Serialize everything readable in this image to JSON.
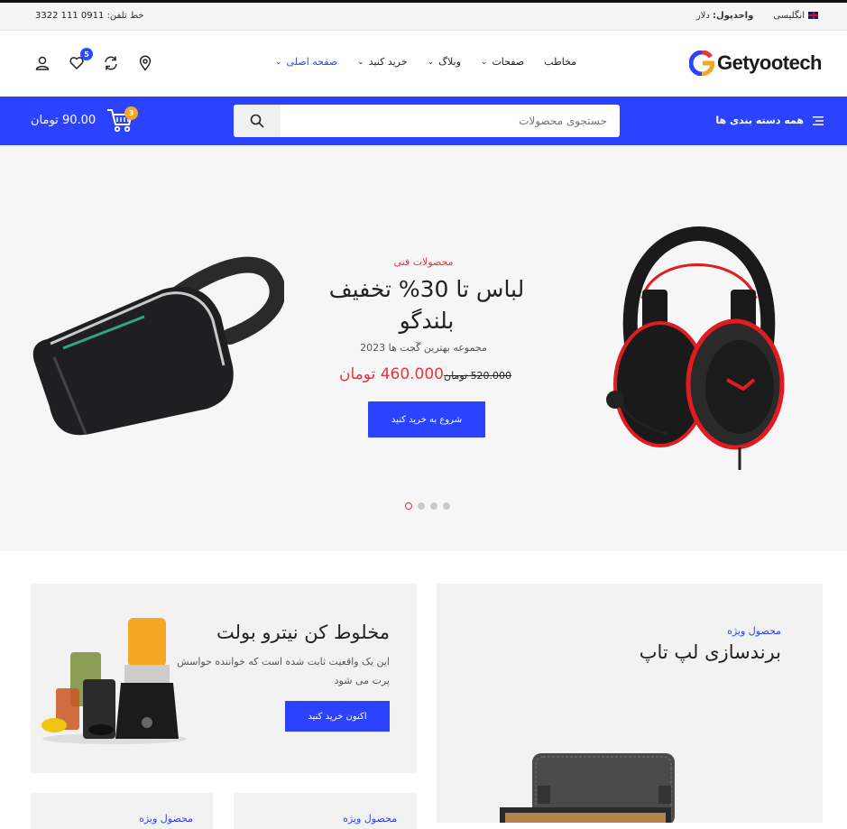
{
  "topbar": {
    "phone_label": "خط تلفن:",
    "phone_number": "0911 111 3322",
    "language": "انگلیسی",
    "currency_label": "واحدپول:",
    "currency_value": "دلار"
  },
  "header": {
    "logo_text": "Getyootech",
    "nav": [
      {
        "label": "صفحه اصلی",
        "active": true,
        "has_dropdown": true
      },
      {
        "label": "خرید کنید",
        "active": false,
        "has_dropdown": true
      },
      {
        "label": "وبلاگ",
        "active": false,
        "has_dropdown": true
      },
      {
        "label": "صفحات",
        "active": false,
        "has_dropdown": true
      },
      {
        "label": "مخاطب",
        "active": false,
        "has_dropdown": false
      }
    ],
    "wishlist_count": "5",
    "icons": [
      "user-icon",
      "heart-icon",
      "compare-icon",
      "location-icon"
    ]
  },
  "bluebar": {
    "categories_label": "همه دسته بندی ها",
    "search_placeholder": "جستجوی محصولات",
    "cart_count": "3",
    "cart_amount": "90.00 تومان"
  },
  "hero": {
    "subtitle": "محصولات فنی",
    "title": "لباس تا 30% تخفیف بلندگو",
    "description": "مجموعه بهترین گَجت ها 2023",
    "old_price": "520.000 تومان",
    "new_price": "460.000 تومان",
    "cta_label": "شروع به خرید کنید",
    "slides": 4,
    "active_slide": 0
  },
  "promos": {
    "blender": {
      "title": "مخلوط کن نیترو بولت",
      "description": "این یک واقعیت ثابت شده است که خواننده حواسش پرت می شود",
      "button": "اکنون خرید کنید"
    },
    "laptop": {
      "label": "محصول ویژه",
      "title": "برندسازی لپ تاپ"
    },
    "small1": {
      "label": "محصول ویژه"
    },
    "small2": {
      "label": "محصول ویژه"
    }
  },
  "colors": {
    "accent": "#2b43ff",
    "sale": "#e8343c",
    "badge": "#f5a623"
  }
}
